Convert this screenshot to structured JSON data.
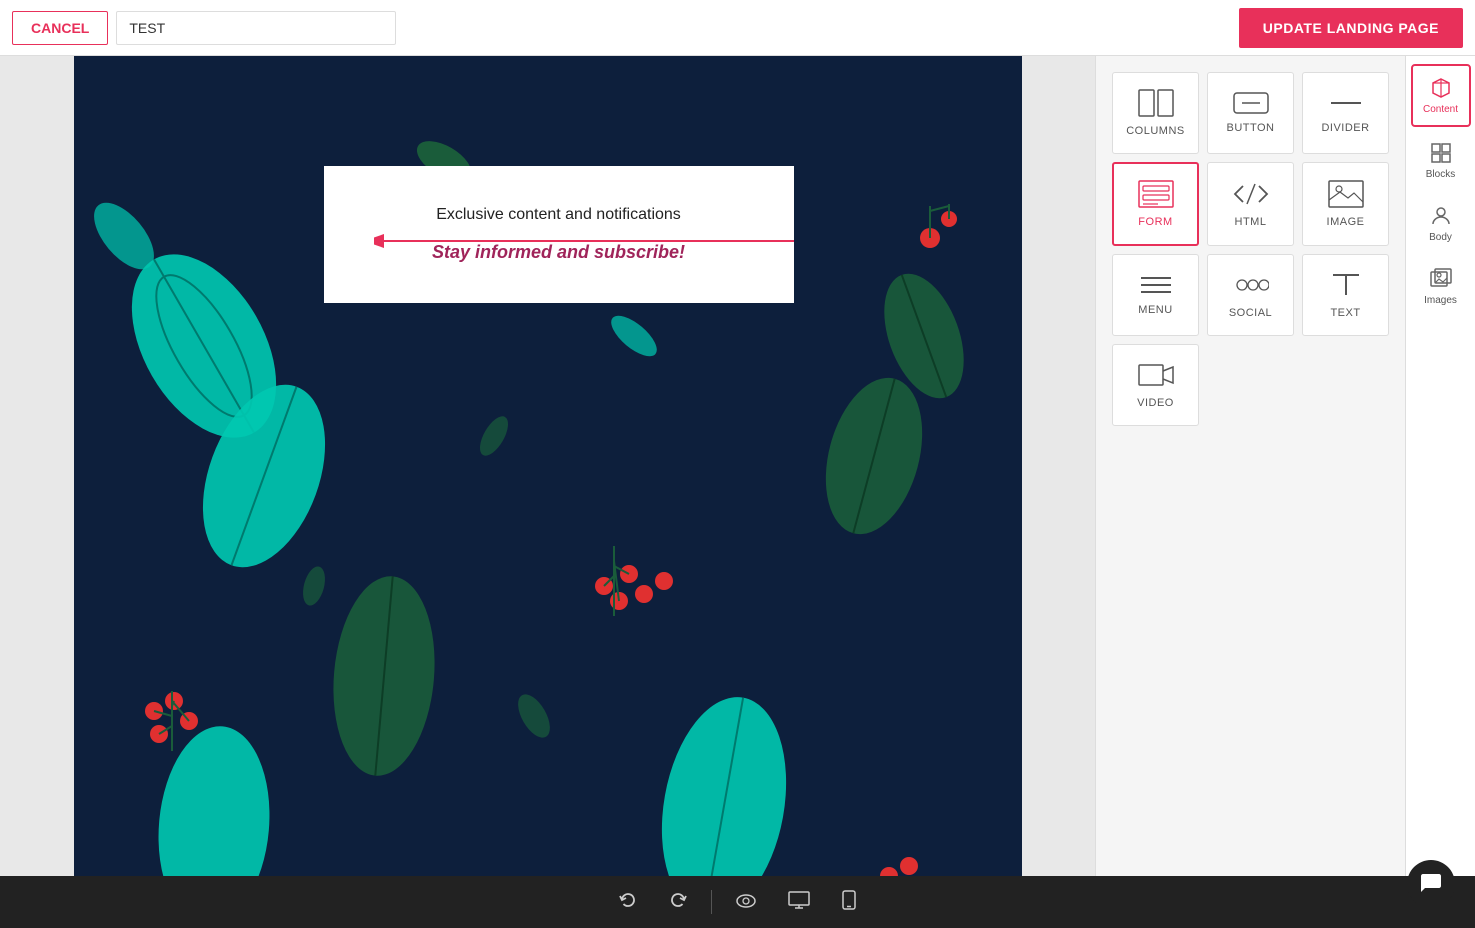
{
  "header": {
    "cancel_label": "CANCEL",
    "page_name": "TEST",
    "update_label": "UPDATE LANDING PAGE"
  },
  "canvas": {
    "content_box": {
      "text1": "Exclusive content and notifications",
      "text2": "Stay informed and subscribe!"
    }
  },
  "panel": {
    "items": [
      {
        "id": "columns",
        "label": "COLUMNS",
        "active": false
      },
      {
        "id": "button",
        "label": "BUTTON",
        "active": false
      },
      {
        "id": "divider",
        "label": "DIVIDER",
        "active": false
      },
      {
        "id": "form",
        "label": "FORM",
        "active": true
      },
      {
        "id": "html",
        "label": "HTML",
        "active": false
      },
      {
        "id": "image",
        "label": "IMAGE",
        "active": false
      },
      {
        "id": "menu",
        "label": "MENU",
        "active": false
      },
      {
        "id": "social",
        "label": "SOCIAL",
        "active": false
      },
      {
        "id": "text",
        "label": "TEXT",
        "active": false
      },
      {
        "id": "video",
        "label": "VIDEO",
        "active": false
      }
    ]
  },
  "sidebar": {
    "items": [
      {
        "id": "content",
        "label": "Content",
        "active": true
      },
      {
        "id": "blocks",
        "label": "Blocks",
        "active": false
      },
      {
        "id": "body",
        "label": "Body",
        "active": false
      },
      {
        "id": "images",
        "label": "Images",
        "active": false
      }
    ]
  },
  "toolbar": {
    "undo": "↺",
    "redo": "↻",
    "preview": "👁",
    "desktop": "🖥",
    "mobile": "📱"
  },
  "colors": {
    "accent": "#e8305a",
    "bg_dark": "#0d1f3c",
    "teal": "#00c9b1",
    "dark_green": "#1a6b4a",
    "red_berry": "#e03030"
  }
}
